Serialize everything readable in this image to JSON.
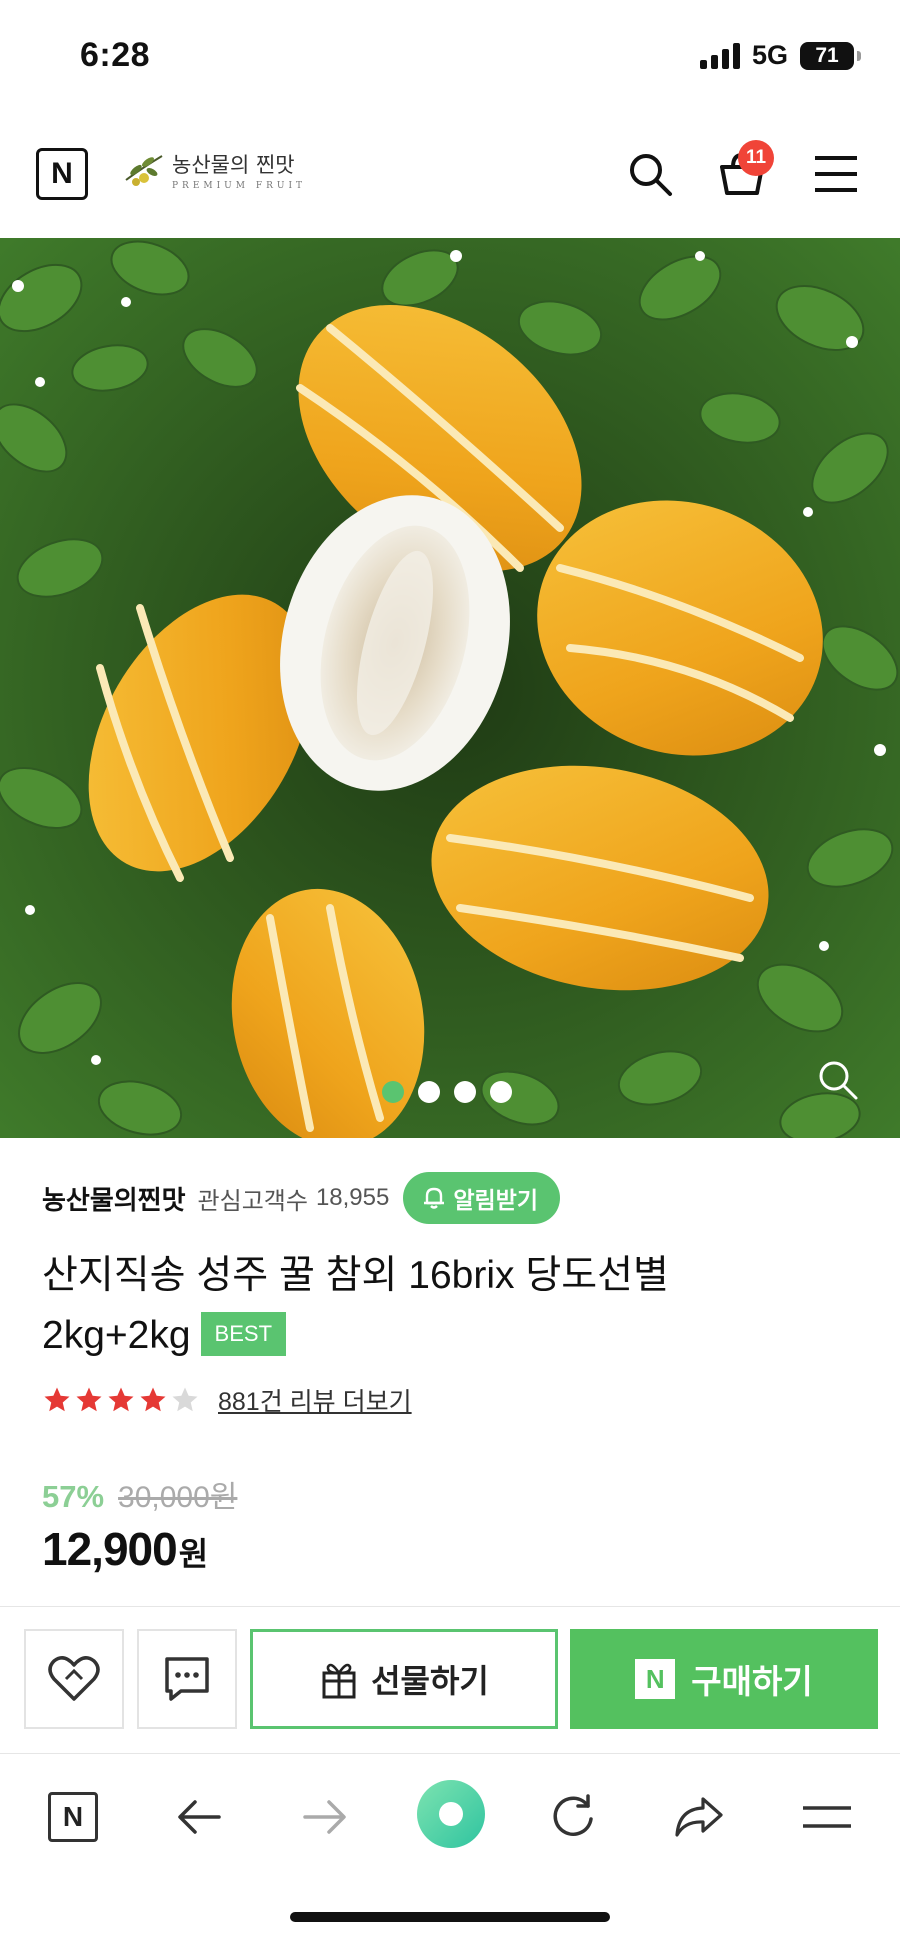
{
  "status_bar": {
    "time": "6:28",
    "network": "5G",
    "battery": "71",
    "icons": [
      "cellular-signal-icon",
      "battery-icon"
    ]
  },
  "header": {
    "logo": "N",
    "brand_name": "농산물의 찐맛",
    "brand_sub": "PREMIUM FRUIT",
    "cart_count": "11",
    "icons": [
      "search-icon",
      "cart-icon",
      "menu-icon"
    ]
  },
  "gallery": {
    "slide_count": 4,
    "active_index": 0,
    "icons": [
      "zoom-icon"
    ]
  },
  "product": {
    "seller": "농산물의찐맛",
    "followers_label": "관심고객수",
    "followers_count": "18,955",
    "alert_button": "알림받기",
    "title_line1": "산지직송 성주 꿀 참외 16brix 당도선별",
    "title_line2": "2kg+2kg",
    "badge": "BEST",
    "rating_stars": 4,
    "rating_max": 5,
    "review_link": "881건 리뷰 더보기",
    "discount": "57%",
    "original_price": "30,000원",
    "price_number": "12,900",
    "price_unit": "원"
  },
  "actions": {
    "gift_label": "선물하기",
    "buy_label": "구매하기",
    "buy_logo": "N",
    "icons": [
      "wishlist-heart-icon",
      "chat-icon",
      "gift-icon"
    ]
  },
  "browser_bar": {
    "home_logo": "N",
    "icons": [
      "back-arrow-icon",
      "forward-arrow-icon",
      "home-circle-icon",
      "refresh-icon",
      "share-icon",
      "menu-icon"
    ]
  },
  "colors": {
    "accent_green": "#5ac470",
    "buy_green": "#54c15f",
    "badge_red": "#f04438",
    "star_red": "#e53935",
    "discount_green": "#8ccf95"
  }
}
